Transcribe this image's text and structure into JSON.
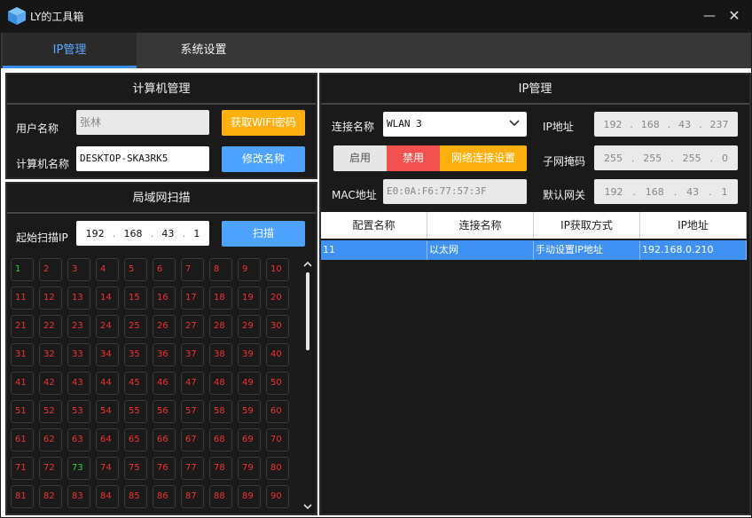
{
  "window": {
    "title": "LY的工具箱",
    "minimize_glyph": "—",
    "close_glyph": "✕",
    "icon": "cube-icon"
  },
  "tabs": [
    {
      "label": "IP管理",
      "active": true
    },
    {
      "label": "系统设置",
      "active": false
    }
  ],
  "computer_panel": {
    "title": "计算机管理",
    "user_label": "用户名称",
    "user_value": "张林",
    "wifi_button": "获取WIFI密码",
    "pc_label": "计算机名称",
    "pc_value": "DESKTOP-SKA3RK5",
    "rename_button": "修改名称"
  },
  "scan_panel": {
    "title": "局域网扫描",
    "start_label": "起始扫描IP",
    "start_ip": [
      "192",
      "168",
      "43",
      "1"
    ],
    "scan_button": "扫描",
    "cells": [
      "1",
      "2",
      "3",
      "4",
      "5",
      "6",
      "7",
      "8",
      "9",
      "10",
      "11",
      "12",
      "13",
      "14",
      "15",
      "16",
      "17",
      "18",
      "19",
      "20",
      "21",
      "22",
      "23",
      "24",
      "25",
      "26",
      "27",
      "28",
      "29",
      "30",
      "31",
      "32",
      "33",
      "34",
      "35",
      "36",
      "37",
      "38",
      "39",
      "40",
      "41",
      "42",
      "43",
      "44",
      "45",
      "46",
      "47",
      "48",
      "49",
      "50",
      "51",
      "52",
      "53",
      "54",
      "55",
      "56",
      "57",
      "58",
      "59",
      "60",
      "61",
      "62",
      "63",
      "64",
      "65",
      "66",
      "67",
      "68",
      "69",
      "70",
      "71",
      "72",
      "73",
      "74",
      "75",
      "76",
      "77",
      "78",
      "79",
      "80",
      "81",
      "82",
      "83",
      "84",
      "85",
      "86",
      "87",
      "88",
      "89",
      "90"
    ],
    "online": [
      "1",
      "73"
    ],
    "colors": {
      "online": "#2ed12e",
      "offline": "#e33333"
    }
  },
  "ip_panel": {
    "title": "IP管理",
    "conn_label": "连接名称",
    "conn_value": "WLAN 3",
    "enable_button": "启用",
    "disable_button": "禁用",
    "net_settings_button": "网络连接设置",
    "mac_label": "MAC地址",
    "mac_value": "E0:0A:F6:77:57:3F",
    "ip_label": "IP地址",
    "ip_value": [
      "192",
      "168",
      "43",
      "237"
    ],
    "mask_label": "子网掩码",
    "mask_value": [
      "255",
      "255",
      "255",
      "0"
    ],
    "gw_label": "默认网关",
    "gw_value": [
      "192",
      "168",
      "43",
      "1"
    ],
    "table": {
      "headers": [
        "配置名称",
        "连接名称",
        "IP获取方式",
        "IP地址"
      ],
      "rows": [
        [
          "11",
          "以太网",
          "手动设置IP地址",
          "192.168.0.210"
        ]
      ]
    }
  },
  "accent_colors": {
    "orange": "#ffb00f",
    "blue": "#4da3ff",
    "red": "#f35050",
    "selected_row": "#3f92f3"
  }
}
